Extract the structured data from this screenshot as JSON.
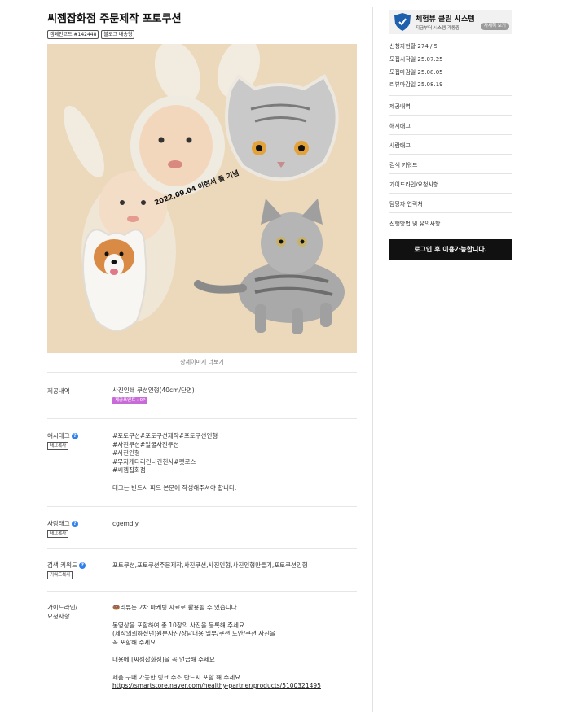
{
  "campaign": {
    "title": "씨젬잡화점 주문제작 포토쿠션",
    "badges": [
      "캠페인코드 #142448",
      "블로그 배송형"
    ]
  },
  "detail": {
    "more_images": "상세이미지 더보기",
    "hero_caption": "2022.09.04 이현서 돌 기념"
  },
  "rows": {
    "provide": {
      "label": "제공내역",
      "value": "사진인쇄 쿠션인형(40cm/단면)",
      "point_badge": "제공포인트 : 0P"
    },
    "hashtag": {
      "label": "해시태그",
      "copy": "태그복사",
      "lines": [
        "#포토쿠션#포토쿠션제작#포토쿠션인형",
        "#사진쿠션#얼굴사진쿠션",
        "#사진인형",
        "#무지개다리건너간친사#펫로스",
        "#씨젬잡화점"
      ],
      "note": "태그는 반드시 피드 본문에 작성해주셔야 합니다."
    },
    "person_tag": {
      "label": "사람태그",
      "copy": "태그복사",
      "value": "cgemdiy"
    },
    "keyword": {
      "label": "검색 키워드",
      "copy": "키워드복사",
      "value": "포토쿠션,포토쿠션주문제작,사진쿠션,사진인형,사진인형만들기,포토쿠션인형"
    },
    "guide": {
      "label_line1": "가이드라인/",
      "label_line2": "요청사항",
      "notice": "🍩리뷰는 2차 마케팅 자료로 활용될 수 있습니다.",
      "lines1": [
        "동영상을 포함하여 총 10장의 사진을 등록해 주세요",
        "(제작의뢰하셨던)원본사진/상담내용 일부/쿠션 도안/쿠션 사진을",
        "꼭 포함해 주세요."
      ],
      "line2": "내용에 [씨젬잡화점]을 꼭 언급해 주세요",
      "line3": "제품 구매 가능한 링크 주소 반드시 포함 해 주세요.",
      "link": "https://smartstore.naver.com/healthy-partner/products/5100321495"
    }
  },
  "sidebar": {
    "clean": {
      "shield_text": "클린 체험 시스템",
      "title": "체험뷰 클린 시스템",
      "subtitle": "지금부터 시스템 가동중",
      "button": "자세히 보기"
    },
    "stats": [
      "신청자현황 274 / 5",
      "모집시작일 25.07.25",
      "모집마감일 25.08.05",
      "리뷰마감일 25.08.19"
    ],
    "menu": [
      "제공내역",
      "해시태그",
      "사람태그",
      "검색 키워드",
      "가이드라인/요청사항",
      "담당자 연락처",
      "진행방법 및 유의사항"
    ],
    "login_button": "로그인 후 이용가능합니다."
  },
  "colors": {
    "hero_bg": "#ecd9bc",
    "point_badge": "#c86ad8",
    "help_icon": "#2f80ed",
    "login_bg": "#111111"
  }
}
